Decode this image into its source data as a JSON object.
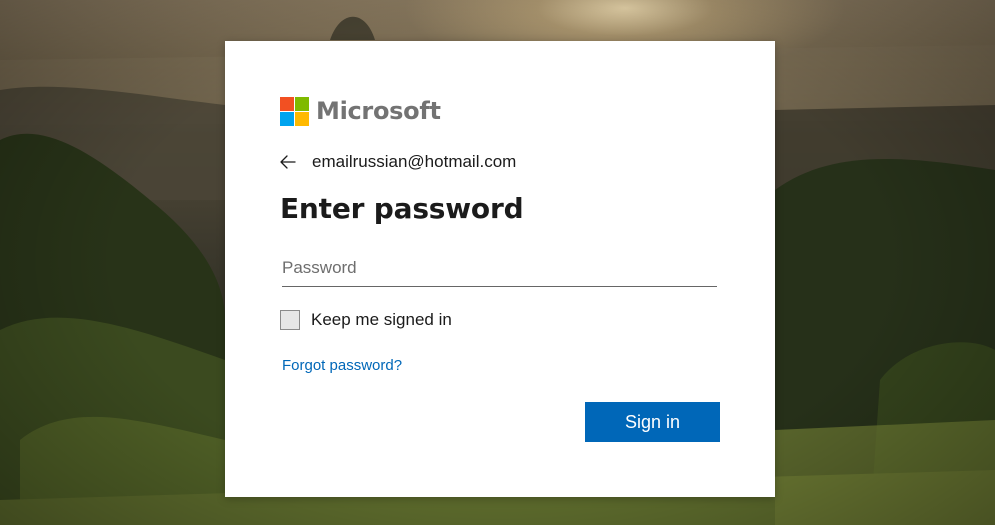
{
  "brand": {
    "name": "Microsoft",
    "logo_colors": [
      "#f25022",
      "#7fba00",
      "#00a4ef",
      "#ffb900"
    ]
  },
  "identity": {
    "email": "emailrussian@hotmail.com",
    "back_icon": "arrow-left-icon"
  },
  "title": "Enter password",
  "password": {
    "placeholder": "Password",
    "value": ""
  },
  "keep_signed_in": {
    "label": "Keep me signed in",
    "checked": false
  },
  "forgot_password": "Forgot password?",
  "signin_button": "Sign in",
  "colors": {
    "accent": "#0067b8",
    "text": "#1b1b1b"
  }
}
